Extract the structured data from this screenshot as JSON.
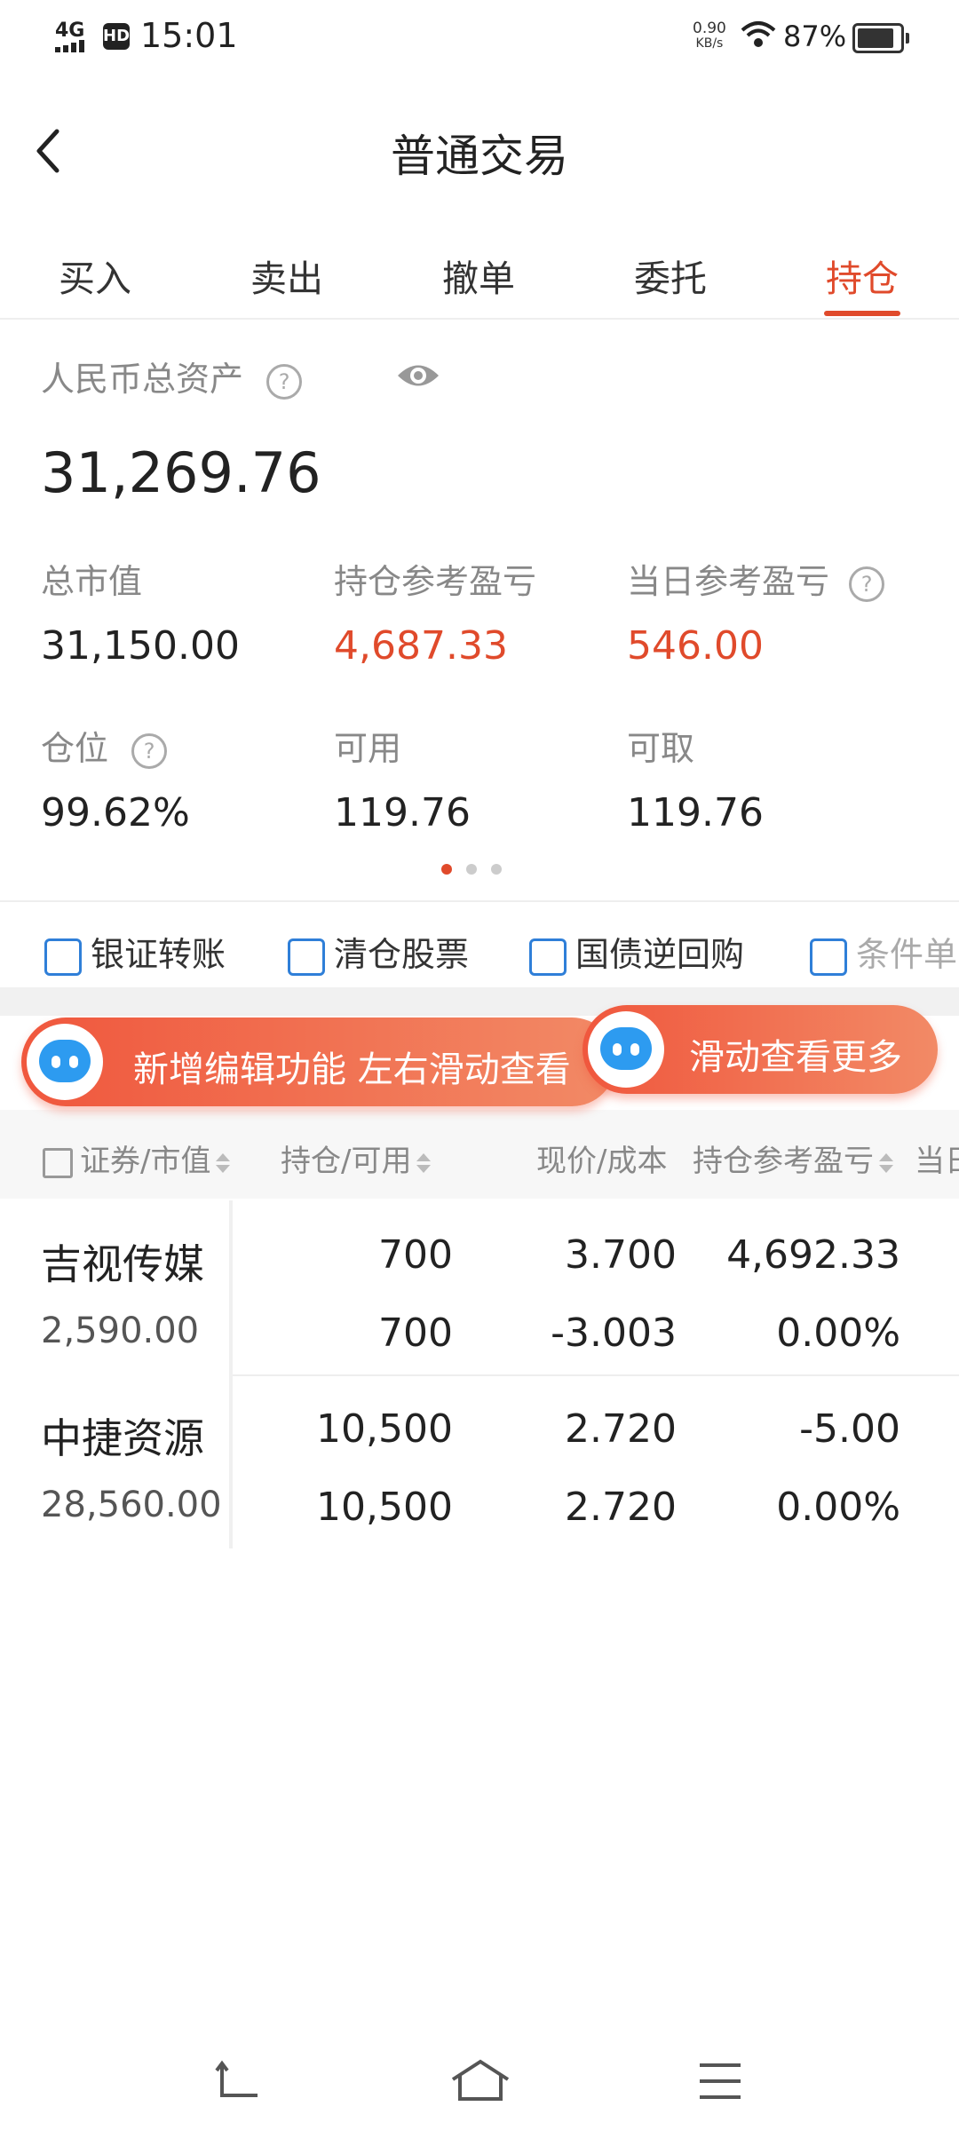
{
  "status_bar": {
    "network": "4G",
    "hd": "HD",
    "time": "15:01",
    "speed_value": "0.90",
    "speed_unit": "KB/s",
    "battery": "87%"
  },
  "header": {
    "title": "普通交易"
  },
  "tabs": [
    {
      "label": "买入"
    },
    {
      "label": "卖出"
    },
    {
      "label": "撤单"
    },
    {
      "label": "委托"
    },
    {
      "label": "持仓"
    }
  ],
  "active_tab": "持仓",
  "assets": {
    "total_label": "人民币总资产",
    "total_value": "31,269.76",
    "market_value_label": "总市值",
    "market_value": "31,150.00",
    "position_pl_label": "持仓参考盈亏",
    "position_pl": "4,687.33",
    "today_pl_label": "当日参考盈亏",
    "today_pl": "546.00",
    "position_ratio_label": "仓位",
    "position_ratio": "99.62%",
    "available_label": "可用",
    "available": "119.76",
    "withdrawable_label": "可取",
    "withdrawable": "119.76",
    "help_glyph": "?"
  },
  "quick_actions": [
    {
      "label": "银证转账",
      "icon": "transfer-icon"
    },
    {
      "label": "清仓股票",
      "icon": "clear-stock-icon"
    },
    {
      "label": "国债逆回购",
      "icon": "repo-icon"
    },
    {
      "label": "条件单",
      "icon": "condition-order-icon"
    }
  ],
  "tips": {
    "tip1": "新增编辑功能 左右滑动查看",
    "tip2": "滑动查看更多"
  },
  "table": {
    "headers": {
      "security": "证券/市值",
      "position": "持仓/可用",
      "price": "现价/成本",
      "pl": "持仓参考盈亏",
      "today": "当日"
    },
    "rows": [
      {
        "name": "吉视传媒",
        "market_value": "2,590.00",
        "position": "700",
        "available": "700",
        "price": "3.700",
        "cost": "-3.003",
        "pl": "4,692.33",
        "pl_pct": "0.00%",
        "color": "#e04a2b"
      },
      {
        "name": "中捷资源",
        "market_value": "28,560.00",
        "position": "10,500",
        "available": "10,500",
        "price": "2.720",
        "cost": "2.720",
        "pl": "-5.00",
        "pl_pct": "0.00%",
        "color": "#2ea84a"
      }
    ]
  },
  "colors": {
    "accent": "#e04a2b",
    "loss": "#2ea84a",
    "icon_blue": "#2f7fd8"
  }
}
